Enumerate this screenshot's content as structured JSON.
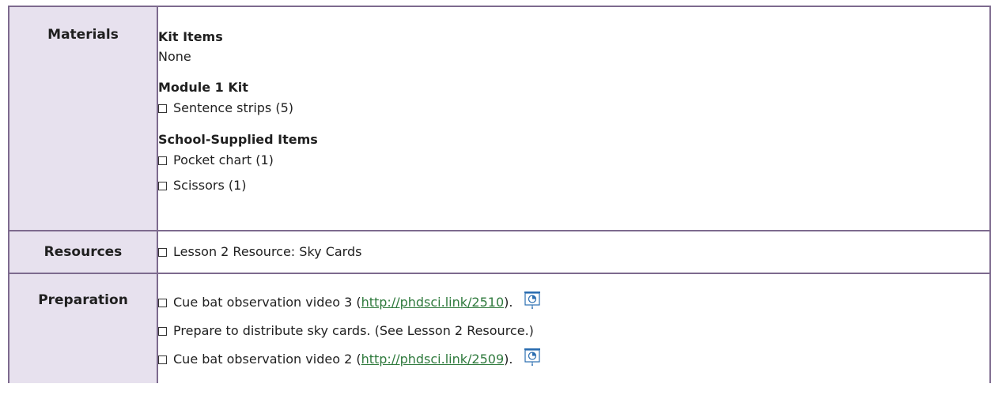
{
  "materials": {
    "label": "Materials",
    "kit_items": {
      "title": "Kit Items",
      "text": "None"
    },
    "module_kit": {
      "title": "Module 1 Kit",
      "items": [
        "Sentence strips (5)"
      ]
    },
    "school_supplied": {
      "title": "School-Supplied Items",
      "items": [
        "Pocket chart (1)",
        "Scissors (1)"
      ]
    }
  },
  "resources": {
    "label": "Resources",
    "items": [
      "Lesson 2 Resource: Sky Cards"
    ]
  },
  "preparation": {
    "label": "Preparation",
    "items": [
      {
        "before": "Cue bat observation video 3 (",
        "link": "http://phdsci.link/2510",
        "after": ").",
        "icon": "video-projector-icon"
      },
      {
        "text": "Prepare to distribute sky cards. (See Lesson 2 Resource.)"
      },
      {
        "before": "Cue bat observation video 2 (",
        "link": "http://phdsci.link/2509",
        "after": ").",
        "icon": "video-projector-icon"
      }
    ]
  },
  "colors": {
    "label_bg": "#e7e1ee",
    "border": "#7d6a8e",
    "link": "#2f7a3d"
  }
}
